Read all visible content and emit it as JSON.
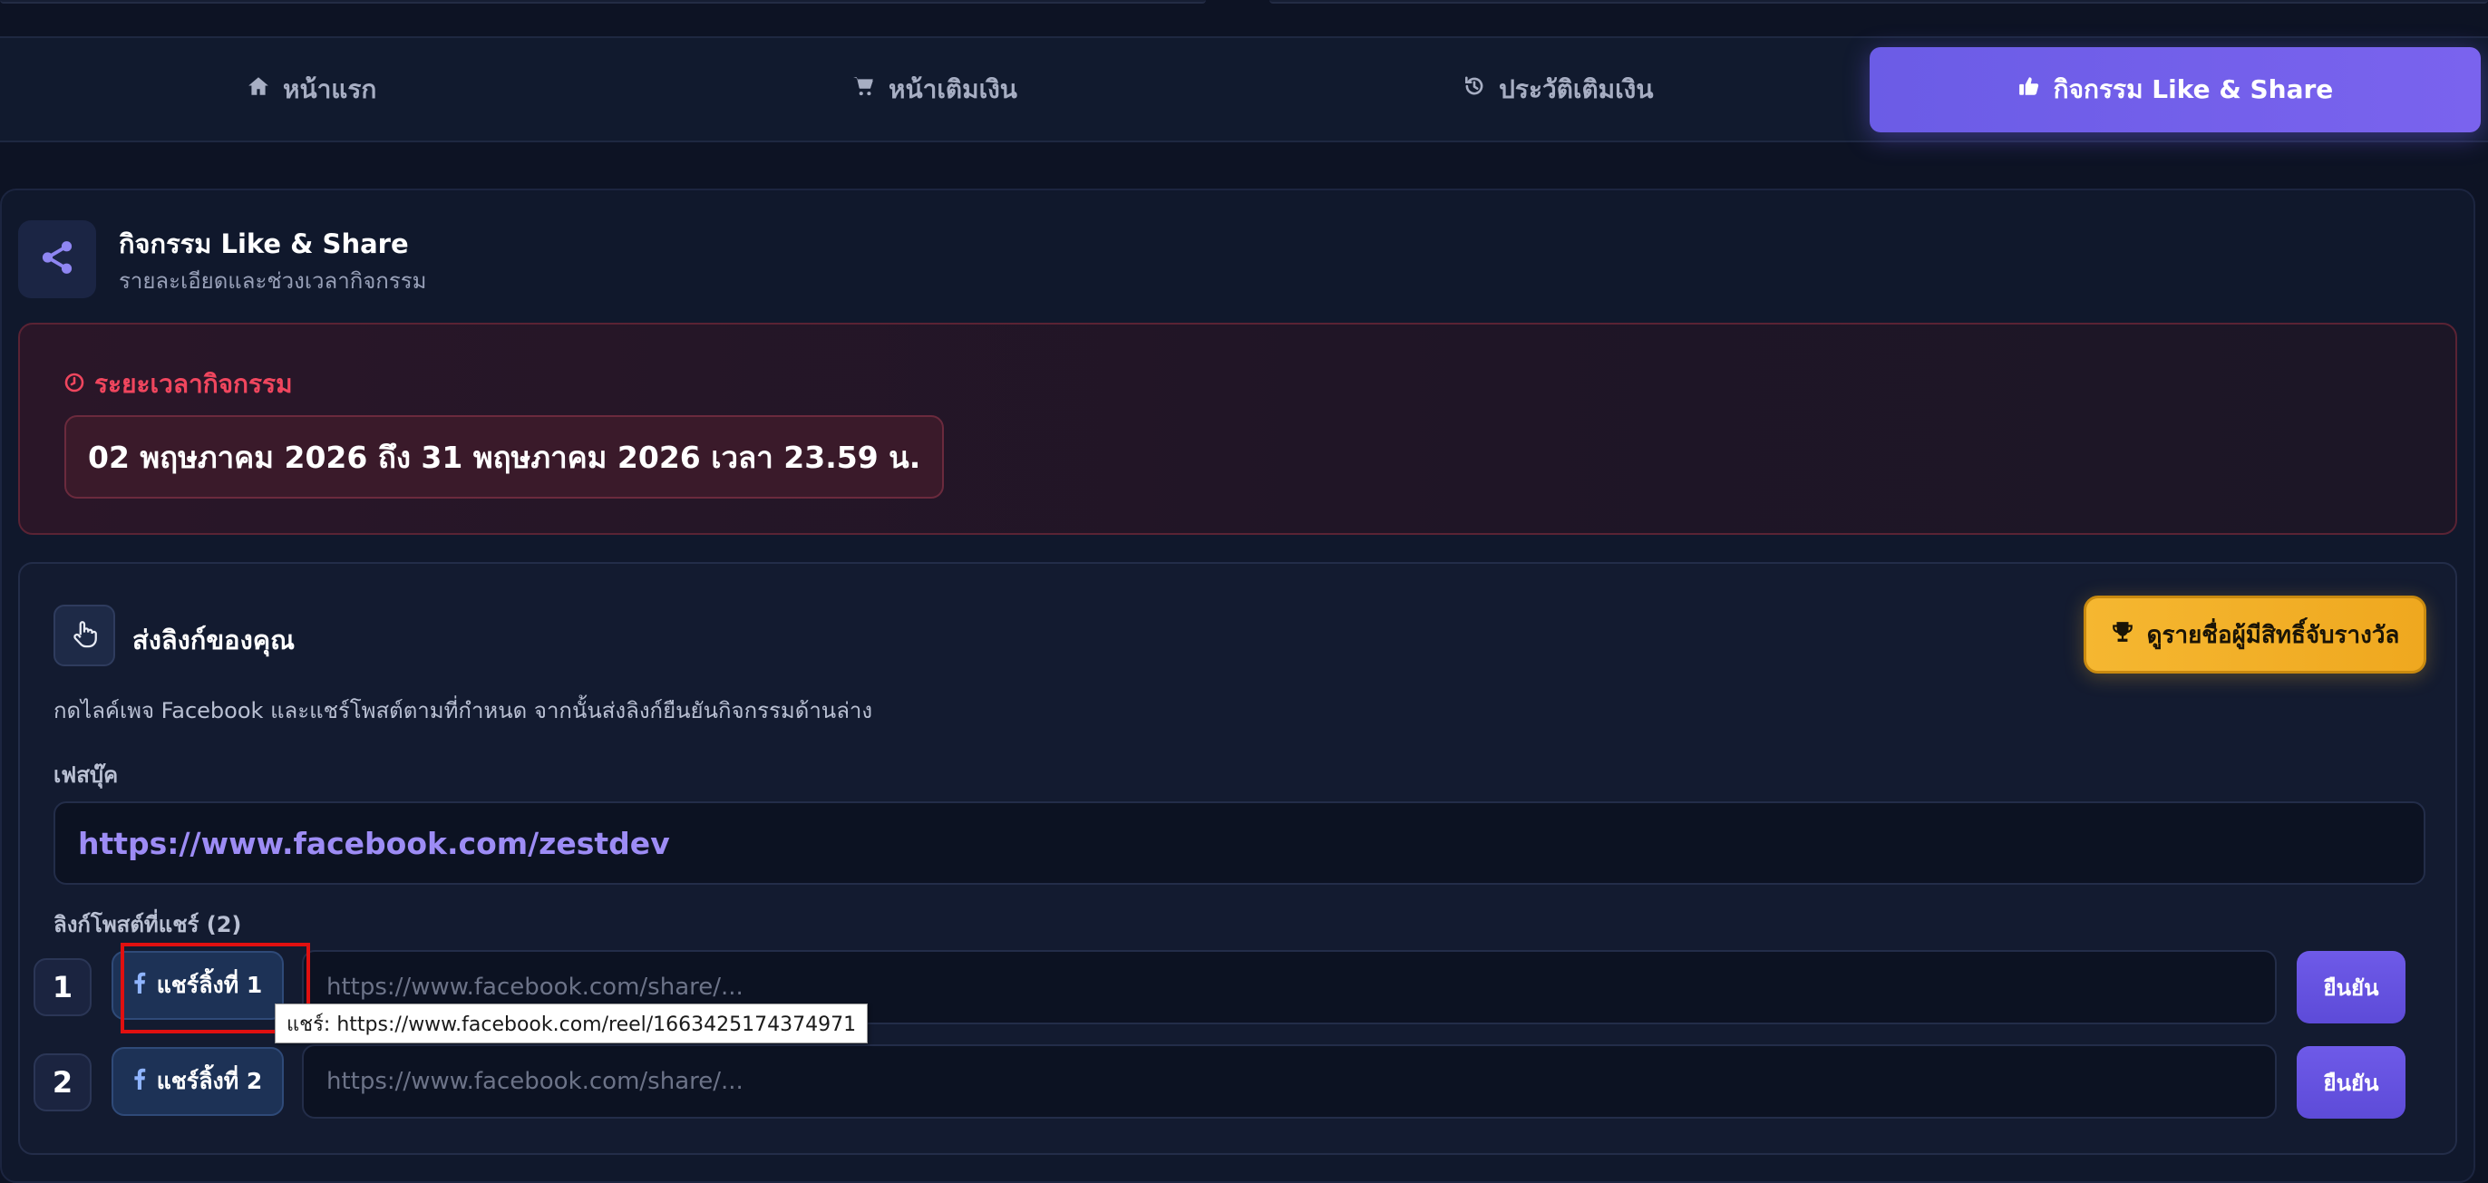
{
  "nav": {
    "items": [
      {
        "label": "หน้าแรก",
        "icon": "home-icon",
        "active": false
      },
      {
        "label": "หน้าเติมเงิน",
        "icon": "cart-icon",
        "active": false
      },
      {
        "label": "ประวัติเติมเงิน",
        "icon": "history-icon",
        "active": false
      },
      {
        "label": "กิจกรรม Like & Share",
        "icon": "thumbs-up-icon",
        "active": true
      }
    ]
  },
  "header": {
    "title": "กิจกรรม Like & Share",
    "subtitle": "รายละเอียดและช่วงเวลากิจกรรม",
    "icon": "share-icon"
  },
  "period": {
    "label": "ระยะเวลากิจกรรม",
    "icon": "clock-icon",
    "value": "02 พฤษภาคม 2026 ถึง 31 พฤษภาคม 2026 เวลา 23.59 น."
  },
  "submit": {
    "title": "ส่งลิงก์ของคุณ",
    "icon": "hand-pointer-icon",
    "winners_button": "ดูรายชื่อผู้มีสิทธิ์จับรางวัล",
    "winners_icon": "trophy-icon",
    "description": "กดไลค์เพจ Facebook และแชร์โพสต์ตามที่กำหนด จากนั้นส่งลิงก์ยืนยันกิจกรรมด้านล่าง",
    "facebook_label": "เฟสบุ๊ค",
    "facebook_url": "https://www.facebook.com/zestdev",
    "shared_label": "ลิงก์โพสต์ที่แชร์ (2)",
    "rows": [
      {
        "number": "1",
        "share_label": "แชร์ลิ้งที่ 1",
        "placeholder": "https://www.facebook.com/share/...",
        "confirm": "ยืนยัน"
      },
      {
        "number": "2",
        "share_label": "แชร์ลิ้งที่ 2",
        "placeholder": "https://www.facebook.com/share/...",
        "confirm": "ยืนยัน"
      }
    ]
  },
  "tooltip": {
    "text": "แชร์: https://www.facebook.com/reel/1663425174374971"
  },
  "colors": {
    "accent": "#6b5ce6",
    "danger": "#f0465e",
    "gold": "#f5b731",
    "background": "#0d1324"
  }
}
